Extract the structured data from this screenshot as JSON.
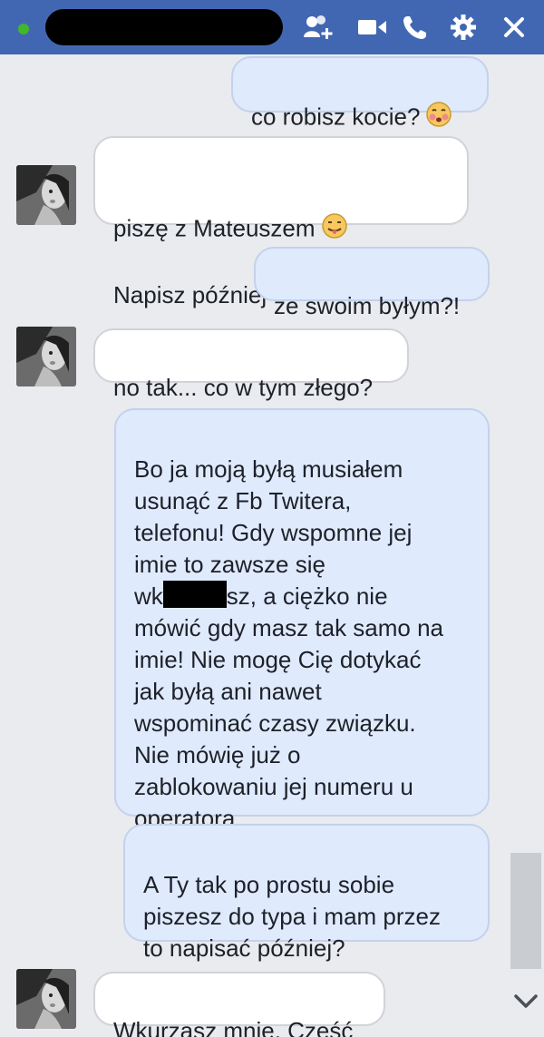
{
  "titlebar": {
    "status": "online",
    "name_redacted": true,
    "icons": [
      "add-friend-icon",
      "video-call-icon",
      "phone-call-icon",
      "settings-gear-icon",
      "close-icon"
    ]
  },
  "messages": [
    {
      "sender": "me",
      "text": "co robisz kocie?",
      "emoji": "blushing-face-emoji"
    },
    {
      "sender": "contact",
      "line1": "piszę z Mateuszem",
      "emoji": "tongue-out-emoji",
      "line2": "Napisz później"
    },
    {
      "sender": "me",
      "text": "ze swoim byłym?!"
    },
    {
      "sender": "contact",
      "text": "no tak... co w tym złego?"
    },
    {
      "sender": "me",
      "part_before_redaction": "Bo ja moją byłą musiałem\nusunąć z Fb Twitera,\ntelefonu! Gdy wspomne jej\nimie to zawsze się\nwk",
      "part_after_redaction": "sz, a ciężko nie\nmówić gdy masz tak samo na\nimie! Nie mogę Cię dotykać\njak byłą ani nawet\nwspominać czasy związku.\nNie mówię już o\nzablokowaniu jej numeru u\noperatora..."
    },
    {
      "sender": "me",
      "text": "A Ty tak po prostu sobie\npiszesz do typa i mam przez\nto napisać później?"
    },
    {
      "sender": "contact",
      "text": "Wkurzasz mnie. Cześć"
    }
  ],
  "colors": {
    "header": "#4267b2",
    "background": "#e9ebee",
    "outgoing_bubble": "#dfeafd",
    "incoming_bubble": "#ffffff",
    "online": "#42b72a"
  }
}
